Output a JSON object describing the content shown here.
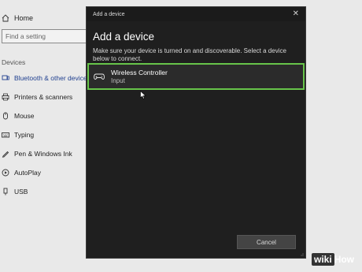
{
  "settings": {
    "home_label": "Home",
    "search_placeholder": "Find a setting",
    "section_label": "Devices",
    "nav_items": [
      {
        "label": "Bluetooth & other devices",
        "icon": "bluetooth-icon",
        "active": true
      },
      {
        "label": "Printers & scanners",
        "icon": "printer-icon"
      },
      {
        "label": "Mouse",
        "icon": "mouse-icon"
      },
      {
        "label": "Typing",
        "icon": "keyboard-icon"
      },
      {
        "label": "Pen & Windows Ink",
        "icon": "pen-icon"
      },
      {
        "label": "AutoPlay",
        "icon": "autoplay-icon"
      },
      {
        "label": "USB",
        "icon": "usb-icon"
      }
    ]
  },
  "dialog": {
    "window_title": "Add a device",
    "heading": "Add a device",
    "instructions": "Make sure your device is turned on and discoverable. Select a device below to connect.",
    "device": {
      "name": "Wireless Controller",
      "type": "Input",
      "icon": "gamepad-icon"
    },
    "cancel_label": "Cancel",
    "colors": {
      "background": "#1f1f1f",
      "selected_border": "#67c44a"
    }
  },
  "watermark": {
    "wiki": "wiki",
    "how": "How"
  }
}
